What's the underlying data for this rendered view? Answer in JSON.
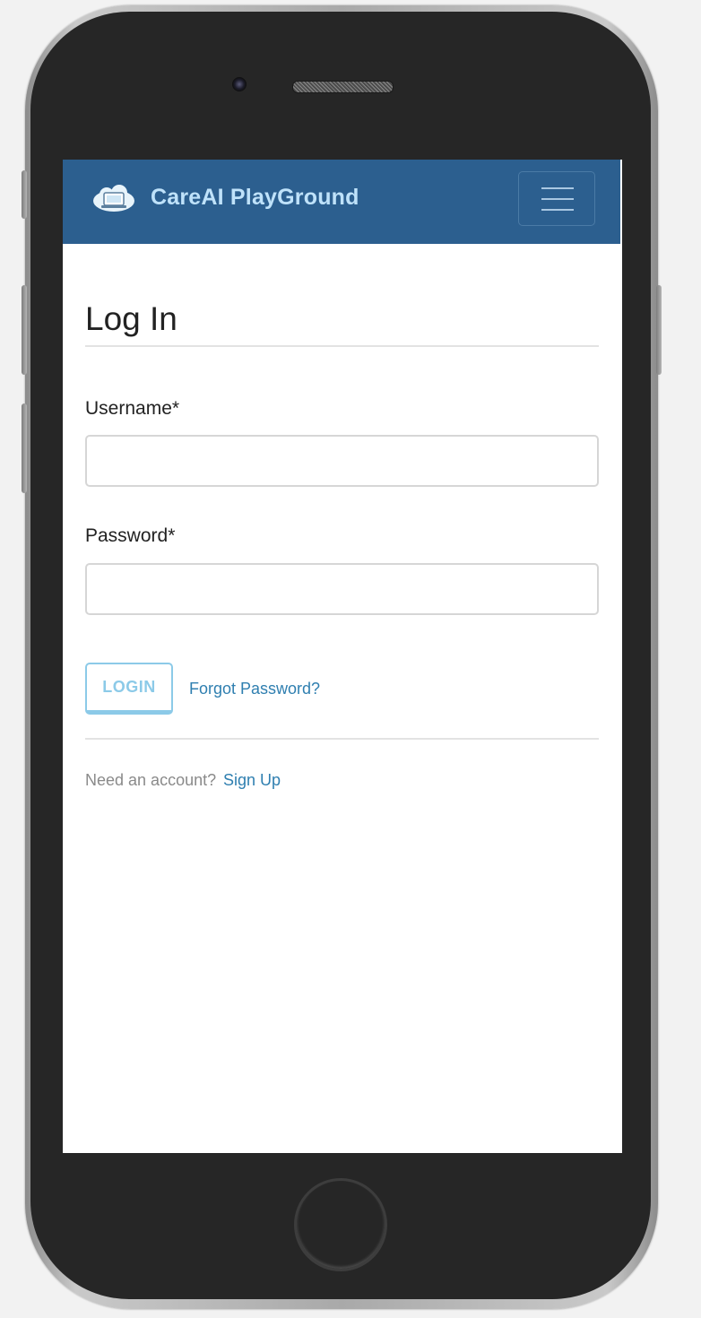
{
  "app": {
    "brand_name": "CareAI PlayGround",
    "brand_logo": "cloud-icon",
    "navbar_color": "#2c5f8f",
    "brand_text_color": "#bfe2fa",
    "menu_icon": "hamburger-menu-icon"
  },
  "login_form": {
    "title": "Log In",
    "username_label": "Username*",
    "username_value": "",
    "password_label": "Password*",
    "password_value": "",
    "login_button_label": "LOGIN",
    "forgot_password_link": "Forgot Password?",
    "signup_prompt": "Need an account?",
    "signup_link": "Sign Up",
    "accent_color": "#8ccae8",
    "link_color": "#2f7fb0"
  }
}
